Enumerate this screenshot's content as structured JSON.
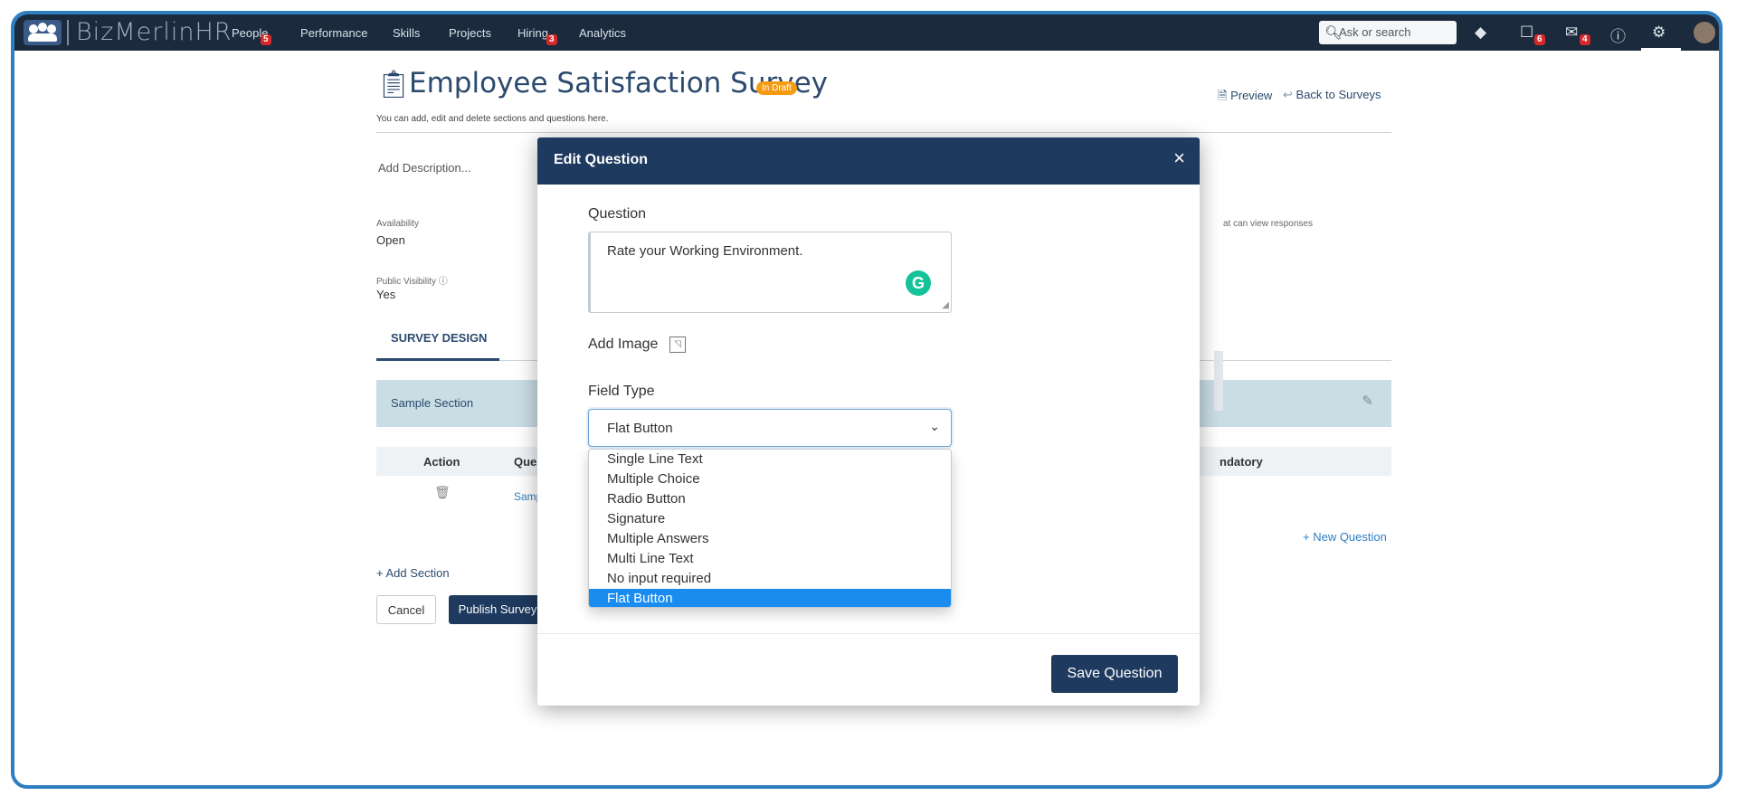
{
  "app": {
    "logo_text": "BizMerlinHR"
  },
  "nav": {
    "items": [
      {
        "label": "People",
        "badge": "5"
      },
      {
        "label": "Performance"
      },
      {
        "label": "Skills"
      },
      {
        "label": "Projects"
      },
      {
        "label": "Hiring",
        "badge": "3"
      },
      {
        "label": "Analytics"
      }
    ],
    "search_placeholder": "Ask or search",
    "notifications_badge": "6",
    "messages_badge": "4"
  },
  "page": {
    "title": "Employee Satisfaction Survey",
    "status_badge": "In Draft",
    "subtitle": "You can add, edit and delete sections and questions here.",
    "preview_link": "Preview",
    "back_link": "Back to Surveys",
    "add_description": "Add Description...",
    "availability_label": "Availability",
    "availability_value": "Open",
    "public_visibility_label": "Public Visibility",
    "public_visibility_value": "Yes",
    "view_responses_fragment": "at can view responses",
    "tab_survey_design": "SURVEY DESIGN",
    "section_name": "Sample Section",
    "table_headers": {
      "action": "Action",
      "question": "Quest",
      "mandatory": "ndatory"
    },
    "row_question_fragment": "Samp",
    "new_question": "+ New Question",
    "add_section": "+ Add Section",
    "cancel_button": "Cancel",
    "publish_button": "Publish Survey"
  },
  "modal": {
    "title": "Edit Question",
    "close": "×",
    "question_label": "Question",
    "question_value": "Rate your Working Environment.",
    "add_image_label": "Add Image",
    "field_type_label": "Field Type",
    "field_type_selected": "Flat Button",
    "field_type_options": [
      "Single Line Text",
      "Multiple Choice",
      "Radio Button",
      "Signature",
      "Multiple Answers",
      "Multi Line Text",
      "No input required",
      "Flat Button"
    ],
    "save_button": "Save Question"
  },
  "colors": {
    "nav_bg": "#1b2a3c",
    "primary": "#1f3a5f",
    "accent_blue": "#2e7ec2",
    "draft_orange": "#f39c12",
    "selected_option": "#1a8cf0",
    "badge_red": "#d62828"
  }
}
